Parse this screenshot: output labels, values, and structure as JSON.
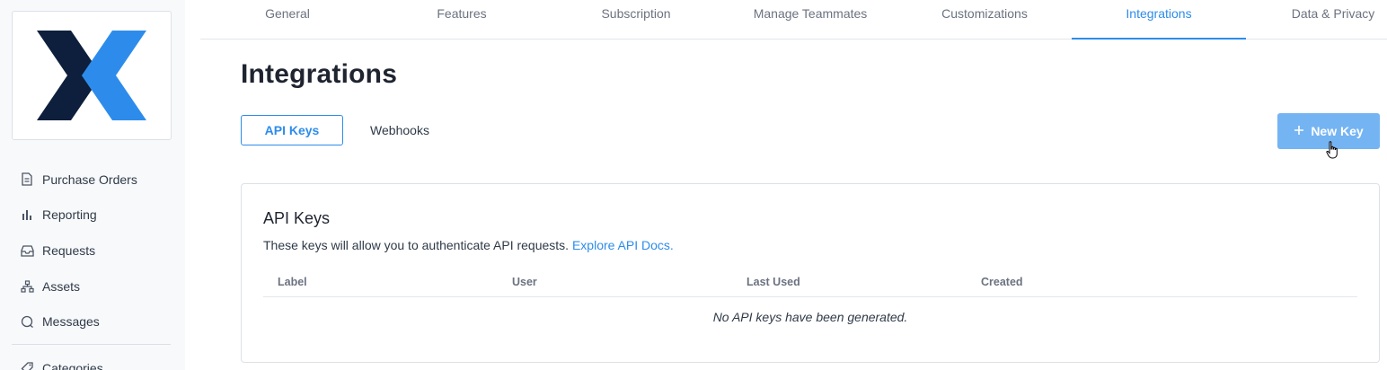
{
  "sidebar": {
    "items": [
      {
        "label": "Purchase Orders",
        "icon": "document-icon"
      },
      {
        "label": "Reporting",
        "icon": "bar-chart-icon"
      },
      {
        "label": "Requests",
        "icon": "inbox-icon"
      },
      {
        "label": "Assets",
        "icon": "hierarchy-icon"
      },
      {
        "label": "Messages",
        "icon": "chat-icon"
      }
    ],
    "extra_item": {
      "label": "Categories",
      "icon": "tag-icon"
    }
  },
  "topnav": {
    "tabs": [
      "General",
      "Features",
      "Subscription",
      "Manage Teammates",
      "Customizations",
      "Integrations",
      "Data & Privacy"
    ],
    "active": "Integrations"
  },
  "main": {
    "title": "Integrations",
    "subtabs": [
      "API Keys",
      "Webhooks"
    ],
    "new_key_label": "New Key",
    "card": {
      "title": "API Keys",
      "description": "These keys will allow you to authenticate API requests.",
      "docs_link": "Explore API Docs.",
      "columns": [
        "Label",
        "User",
        "Last Used",
        "Created"
      ],
      "empty_message": "No API keys have been generated."
    }
  },
  "colors": {
    "accent": "#2d8ceb",
    "button_bg": "#74b4f3",
    "logo_dark": "#0d1f3c",
    "logo_blue": "#2d8ceb"
  }
}
